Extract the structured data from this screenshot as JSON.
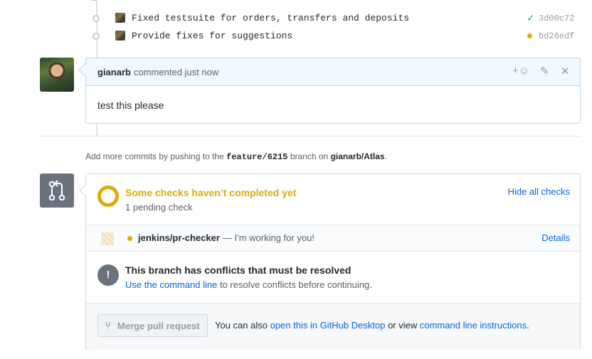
{
  "commits": [
    {
      "message": "Fixed testsuite for orders, transfers and deposits",
      "sha": "3d00c72",
      "status": "success"
    },
    {
      "message": "Provide fixes for suggestions",
      "sha": "bd26edf",
      "status": "pending"
    }
  ],
  "comment": {
    "author": "gianarb",
    "meta": "commented just now",
    "body": "test this please",
    "icons": [
      "add-reaction-icon",
      "pencil-icon",
      "close-icon"
    ],
    "reaction_label": "+☺"
  },
  "push_note": {
    "prefix": "Add more commits by pushing to the ",
    "branch": "feature/6215",
    "middle": " branch on ",
    "repo": "gianarb/Atlas",
    "suffix": "."
  },
  "checks": {
    "title": "Some checks haven’t completed yet",
    "subtitle": "1 pending check",
    "hide_label": "Hide all checks",
    "items": [
      {
        "name": "jenkins/pr-checker",
        "description": "— I'm working for you!",
        "details_label": "Details"
      }
    ]
  },
  "conflict": {
    "title": "This branch has conflicts that must be resolved",
    "link": "Use the command line",
    "rest": " to resolve conflicts before continuing."
  },
  "merge": {
    "button_label": "Merge pull request",
    "text_prefix": "You can also ",
    "desktop_link": "open this in GitHub Desktop",
    "text_middle": " or view ",
    "cli_link": "command line instructions",
    "text_suffix": "."
  },
  "colors": {
    "pending": "#dbab09",
    "success": "#28a745",
    "link": "#0366d6",
    "comment_header": "#f1f8ff"
  }
}
